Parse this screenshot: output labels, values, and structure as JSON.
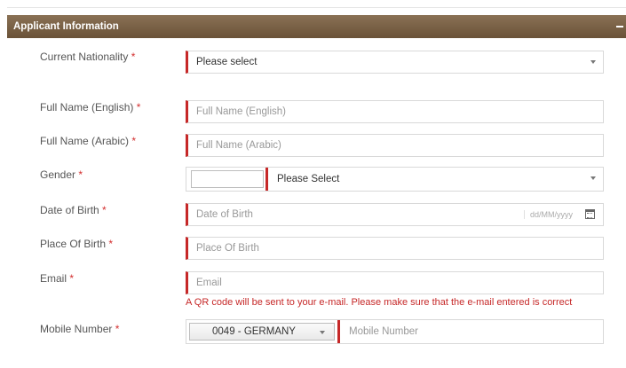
{
  "panel": {
    "title": "Applicant Information"
  },
  "required_mark": "*",
  "fields": {
    "nationality": {
      "label": "Current Nationality",
      "value": "Please select"
    },
    "full_name_en": {
      "label": "Full Name (English)",
      "placeholder": "Full Name (English)"
    },
    "full_name_ar": {
      "label": "Full Name (Arabic)",
      "placeholder": "Full Name (Arabic)"
    },
    "gender": {
      "label": "Gender",
      "value": "Please Select"
    },
    "dob": {
      "label": "Date of Birth",
      "placeholder": "Date of Birth",
      "format_hint": "dd/MM/yyyy"
    },
    "place_of_birth": {
      "label": "Place Of Birth",
      "placeholder": "Place Of Birth"
    },
    "email": {
      "label": "Email",
      "placeholder": "Email",
      "note": "A QR code will be sent to your e-mail. Please make sure that the e-mail entered is correct"
    },
    "mobile": {
      "label": "Mobile Number",
      "country_code": "0049 - GERMANY",
      "placeholder": "Mobile Number"
    }
  },
  "colors": {
    "header_bg": "#7a6147",
    "required": "#d32f2f",
    "accent_border": "#c62828"
  }
}
